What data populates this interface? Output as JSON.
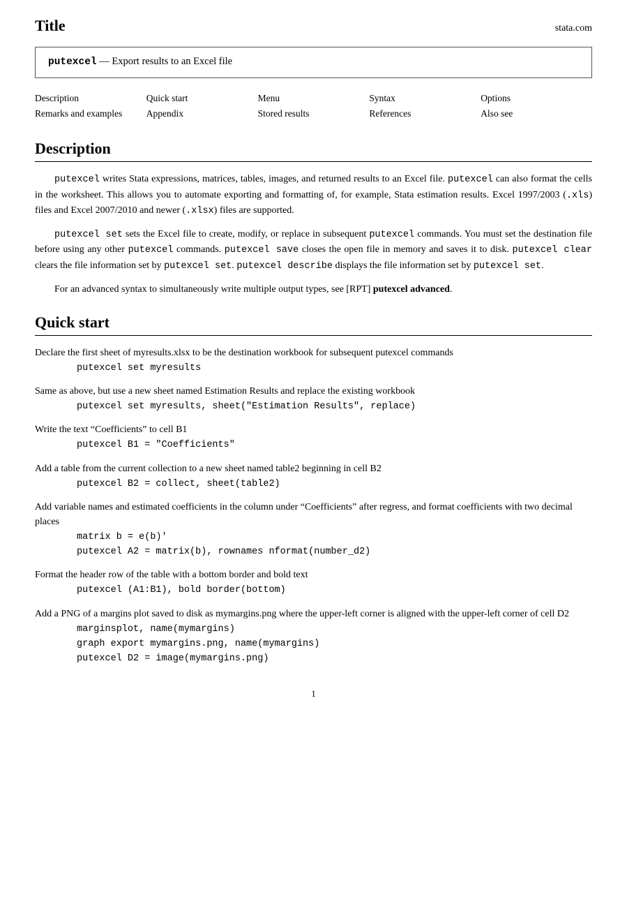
{
  "header": {
    "title": "Title",
    "domain": "stata.com"
  },
  "title_box": {
    "cmd": "putexcel",
    "dash": "—",
    "description": "Export results to an Excel file"
  },
  "nav": {
    "rows": [
      [
        "Description",
        "Quick start",
        "Menu",
        "Syntax",
        "Options"
      ],
      [
        "Remarks and examples",
        "Appendix",
        "Stored results",
        "References",
        "Also see"
      ]
    ]
  },
  "description": {
    "heading": "Description",
    "paragraphs": [
      "putexcel writes Stata expressions, matrices, tables, images, and returned results to an Excel file. putexcel can also format the cells in the worksheet. This allows you to automate exporting and formatting of, for example, Stata estimation results. Excel 1997/2003 (.xls) files and Excel 2007/2010 and newer (.xlsx) files are supported.",
      "putexcel set sets the Excel file to create, modify, or replace in subsequent putexcel commands. You must set the destination file before using any other putexcel commands. putexcel save closes the open file in memory and saves it to disk. putexcel clear clears the file information set by putexcel set. putexcel describe displays the file information set by putexcel set.",
      "For an advanced syntax to simultaneously write multiple output types, see [RPT] putexcel advanced."
    ]
  },
  "quick_start": {
    "heading": "Quick start",
    "items": [
      {
        "desc": "Declare the first sheet of myresults.xlsx to be the destination workbook for subsequent putexcel commands",
        "desc_cont": null,
        "codes": [
          "putexcel set myresults"
        ]
      },
      {
        "desc": "Same as above, but use a new sheet named Estimation Results and replace the existing workbook",
        "desc_cont": null,
        "codes": [
          "putexcel set myresults, sheet(\"Estimation Results\", replace)"
        ]
      },
      {
        "desc": "Write the text “Coefficients” to cell B1",
        "desc_cont": null,
        "codes": [
          "putexcel B1 = \"Coefficients\""
        ]
      },
      {
        "desc": "Add a table from the current collection to a new sheet named table2 beginning in cell B2",
        "desc_cont": null,
        "codes": [
          "putexcel B2 = collect, sheet(table2)"
        ]
      },
      {
        "desc": "Add variable names and estimated coefficients in the column under “Coefficients” after regress, and format coefficients with two decimal places",
        "desc_cont": null,
        "codes": [
          "matrix b = e(b)'",
          "putexcel A2 = matrix(b), rownames nformat(number_d2)"
        ]
      },
      {
        "desc": "Format the header row of the table with a bottom border and bold text",
        "desc_cont": null,
        "codes": [
          "putexcel (A1:B1), bold border(bottom)"
        ]
      },
      {
        "desc": "Add a PNG of a margins plot saved to disk as mymargins.png where the upper-left corner is aligned with the upper-left corner of cell D2",
        "desc_cont": null,
        "codes": [
          "marginsplot, name(mymargins)",
          "graph export mymargins.png, name(mymargins)",
          "putexcel D2 = image(mymargins.png)"
        ]
      }
    ]
  },
  "page_number": "1"
}
